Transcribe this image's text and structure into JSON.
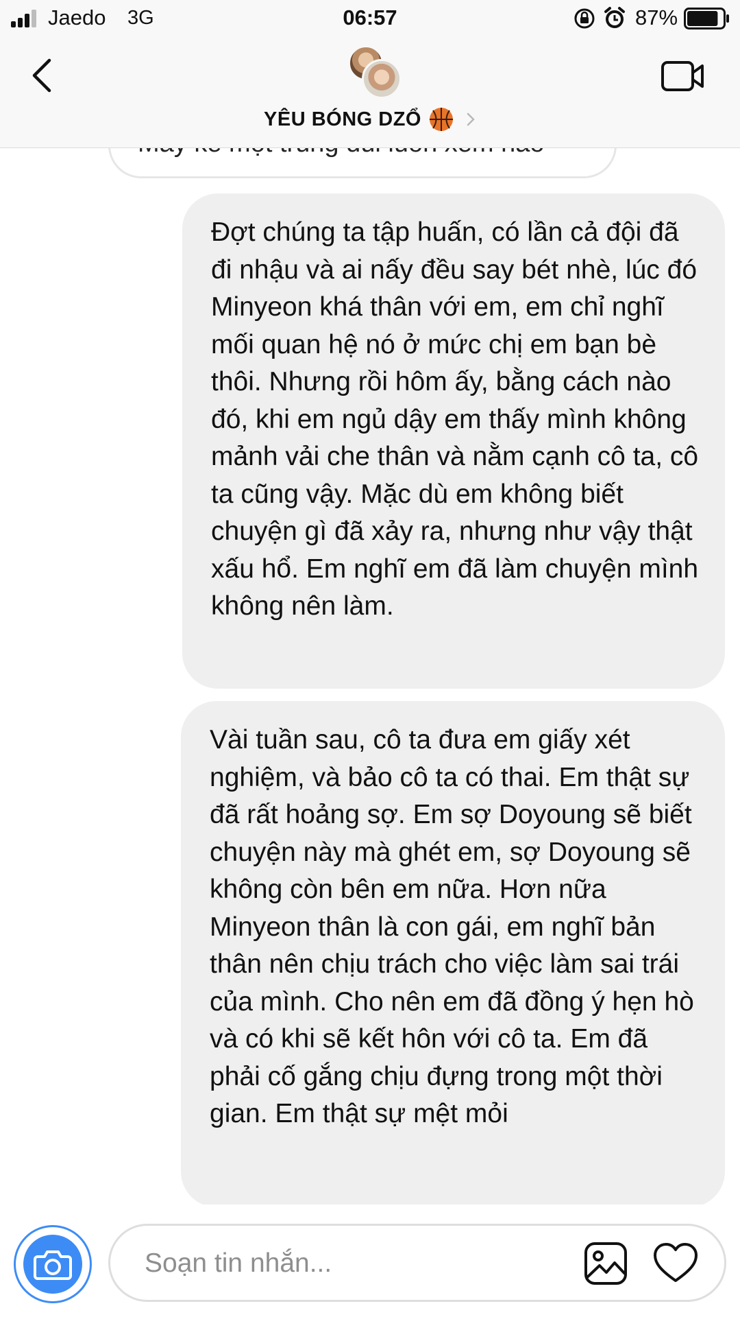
{
  "status_bar": {
    "carrier": "Jaedo",
    "network": "3G",
    "time": "06:57",
    "battery_percent": "87%",
    "battery_level": 0.87,
    "signal_bars": 3
  },
  "header": {
    "title": "YÊU BÓNG DZỔ",
    "title_emoji_icon": "basketball-icon",
    "back_icon": "chevron-left-icon",
    "video_icon": "video-camera-icon"
  },
  "messages": {
    "partial_top": "Mấy kể một trúng đúi luôn xem nào",
    "items": [
      {
        "side": "right",
        "text": "Đợt chúng ta tập huấn, có lần cả đội đã đi nhậu và ai nấy đều say bét nhè, lúc đó Minyeon khá thân với em, em chỉ nghĩ mối quan hệ nó ở mức chị em bạn bè thôi. Nhưng rồi hôm ấy, bằng cách nào đó, khi em ngủ dậy em thấy mình không mảnh vải che thân và nằm cạnh cô ta, cô ta cũng vậy. Mặc dù em không biết chuyện gì đã xảy ra, nhưng như vậy thật xấu hổ. Em nghĩ em đã làm chuyện mình không nên làm."
      },
      {
        "side": "right",
        "text": "Vài tuần sau, cô ta đưa em giấy xét nghiệm, và bảo cô ta có thai. Em thật sự đã rất hoảng sợ. Em sợ Doyoung sẽ biết chuyện này mà ghét em, sợ Doyoung sẽ không còn bên em nữa. Hơn nữa Minyeon thân là con gái, em nghĩ bản thân nên chịu trách cho việc làm sai trái của mình. Cho nên em đã đồng ý hẹn hò và có khi sẽ kết hôn với cô ta. Em đã phải cố gắng chịu đựng trong một thời gian. Em thật sự mệt mỏi"
      }
    ]
  },
  "composer": {
    "placeholder": "Soạn tin nhắn...",
    "camera_icon": "camera-icon",
    "gallery_icon": "image-icon",
    "like_icon": "heart-icon",
    "accent_color": "#3d8cf5"
  }
}
